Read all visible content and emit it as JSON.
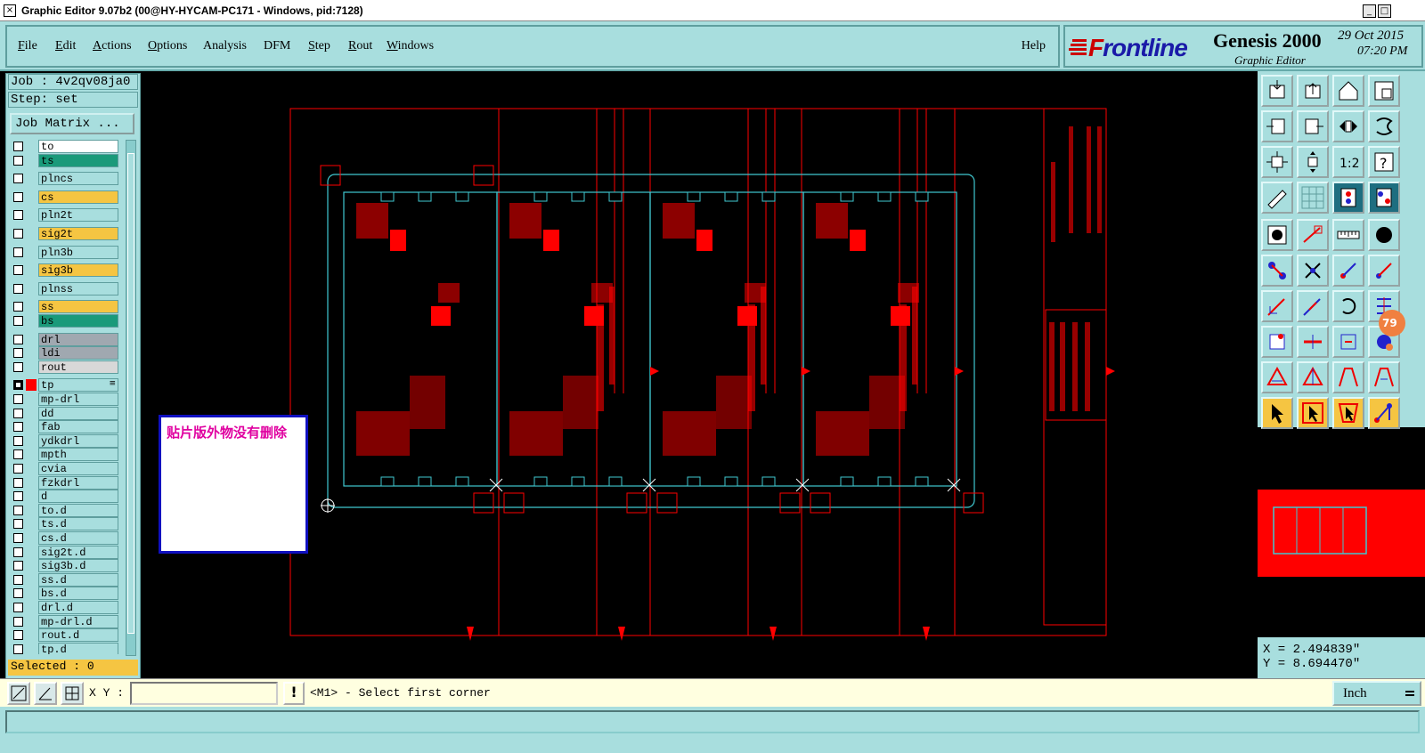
{
  "window": {
    "title": "Graphic Editor 9.07b2 (00@HY-HYCAM-PC171 - Windows, pid:7128)",
    "minimize": "_",
    "maximize": "□",
    "close": "×"
  },
  "menu": {
    "items": [
      {
        "first": "F",
        "rest": "ile"
      },
      {
        "first": "E",
        "rest": "dit"
      },
      {
        "first": "A",
        "rest": "ctions"
      },
      {
        "first": "O",
        "rest": "ptions"
      },
      {
        "first": "",
        "rest": "Analysis"
      },
      {
        "first": "",
        "rest": "DFM"
      },
      {
        "first": "S",
        "rest": "tep"
      },
      {
        "first": "R",
        "rest": "out"
      },
      {
        "first": "W",
        "rest": "indows"
      }
    ],
    "help": "Help"
  },
  "brand": {
    "logo_f": "F",
    "logo_rest": "rontline",
    "product": "Genesis 2000",
    "subtitle": "Graphic Editor",
    "date": "29 Oct 2015",
    "time": "07:20 PM"
  },
  "job": {
    "job_line": "Job : 4v2qv08ja0",
    "step_line": "Step: set",
    "matrix_button": "Job Matrix ..."
  },
  "layers": [
    {
      "name": "to",
      "bg": "#ffffff",
      "on": false,
      "gap": false
    },
    {
      "name": "ts",
      "bg": "#1a9a7a",
      "on": false,
      "gap": false
    },
    {
      "name": "plncs",
      "bg": "#a8dede",
      "on": false,
      "gap": true
    },
    {
      "name": "cs",
      "bg": "#f5c542",
      "on": false,
      "gap": true
    },
    {
      "name": "pln2t",
      "bg": "#a8dede",
      "on": false,
      "gap": true
    },
    {
      "name": "sig2t",
      "bg": "#f5c542",
      "on": false,
      "gap": true
    },
    {
      "name": "pln3b",
      "bg": "#a8dede",
      "on": false,
      "gap": true
    },
    {
      "name": "sig3b",
      "bg": "#f5c542",
      "on": false,
      "gap": true
    },
    {
      "name": "plnss",
      "bg": "#a8dede",
      "on": false,
      "gap": true
    },
    {
      "name": "ss",
      "bg": "#f5c542",
      "on": false,
      "gap": true
    },
    {
      "name": "bs",
      "bg": "#1a9a7a",
      "on": false,
      "gap": false
    },
    {
      "name": "drl",
      "bg": "#a0a8b0",
      "on": false,
      "gap": true
    },
    {
      "name": "ldi",
      "bg": "#a0a8b0",
      "on": false,
      "gap": false
    },
    {
      "name": "rout",
      "bg": "#d8d8d8",
      "on": false,
      "gap": false
    },
    {
      "name": "tp",
      "bg": "#a8dede",
      "on": true,
      "gap": true,
      "active": true,
      "mark": "≡"
    },
    {
      "name": "mp-drl",
      "bg": "#a8dede",
      "on": false,
      "gap": false
    },
    {
      "name": "dd",
      "bg": "#a8dede",
      "on": false,
      "gap": false
    },
    {
      "name": "fab",
      "bg": "#a8dede",
      "on": false,
      "gap": false
    },
    {
      "name": "ydkdrl",
      "bg": "#a8dede",
      "on": false,
      "gap": false
    },
    {
      "name": "mpth",
      "bg": "#a8dede",
      "on": false,
      "gap": false
    },
    {
      "name": "cvia",
      "bg": "#a8dede",
      "on": false,
      "gap": false
    },
    {
      "name": "fzkdrl",
      "bg": "#a8dede",
      "on": false,
      "gap": false
    },
    {
      "name": "d",
      "bg": "#a8dede",
      "on": false,
      "gap": false
    },
    {
      "name": "to.d",
      "bg": "#a8dede",
      "on": false,
      "gap": false
    },
    {
      "name": "ts.d",
      "bg": "#a8dede",
      "on": false,
      "gap": false
    },
    {
      "name": "cs.d",
      "bg": "#a8dede",
      "on": false,
      "gap": false
    },
    {
      "name": "sig2t.d",
      "bg": "#a8dede",
      "on": false,
      "gap": false
    },
    {
      "name": "sig3b.d",
      "bg": "#a8dede",
      "on": false,
      "gap": false
    },
    {
      "name": "ss.d",
      "bg": "#a8dede",
      "on": false,
      "gap": false
    },
    {
      "name": "bs.d",
      "bg": "#a8dede",
      "on": false,
      "gap": false
    },
    {
      "name": "drl.d",
      "bg": "#a8dede",
      "on": false,
      "gap": false
    },
    {
      "name": "mp-drl.d",
      "bg": "#a8dede",
      "on": false,
      "gap": false
    },
    {
      "name": "rout.d",
      "bg": "#a8dede",
      "on": false,
      "gap": false
    },
    {
      "name": "tp.d",
      "bg": "#a8dede",
      "on": false,
      "gap": false
    }
  ],
  "selected": "Selected : 0",
  "annotation": "贴片版外物没有删除",
  "badge": "79",
  "coords": {
    "x": "X = 2.494839\"",
    "y": "Y = 8.694470\""
  },
  "command": {
    "xy_label": "X Y :",
    "xy_value": "",
    "warn": "!",
    "prompt": "<M1> - Select first corner",
    "units": "Inch"
  },
  "colors": {
    "panel": "#a8dede",
    "board": "#ff0000",
    "outline": "#40c8d0",
    "yellow": "#f5c542"
  },
  "tools": [
    "home-step-icon",
    "open-step-icon",
    "house-icon",
    "zoom-window-icon",
    "prev-view-icon",
    "next-view-icon",
    "pan-icon",
    "measure-help-icon",
    "zoom-fit-icon",
    "zoom-center-icon",
    "zoom-ratio-icon",
    "help-question-icon",
    "pencil-icon",
    "grid-icon",
    "snap-red-icon",
    "snap-blue-icon",
    "fill-icon",
    "line-icon",
    "ruler-icon",
    "circle-icon",
    "nodes-icon",
    "cross-icon",
    "vector-icon",
    "vector-alt-icon",
    "arc-icon",
    "arc-alt-icon",
    "rotate-icon",
    "mirror-icon",
    "rect-icon",
    "line-red-icon",
    "align-icon",
    "transform-icon",
    "triangle-icon",
    "triangle-alt-icon",
    "arch-icon",
    "arch-alt-icon",
    "select-arrow-icon",
    "select-box-icon",
    "select-shape-icon",
    "select-net-icon"
  ],
  "tool_labels": {
    "zoom_ratio": "1:2",
    "question": "?"
  }
}
